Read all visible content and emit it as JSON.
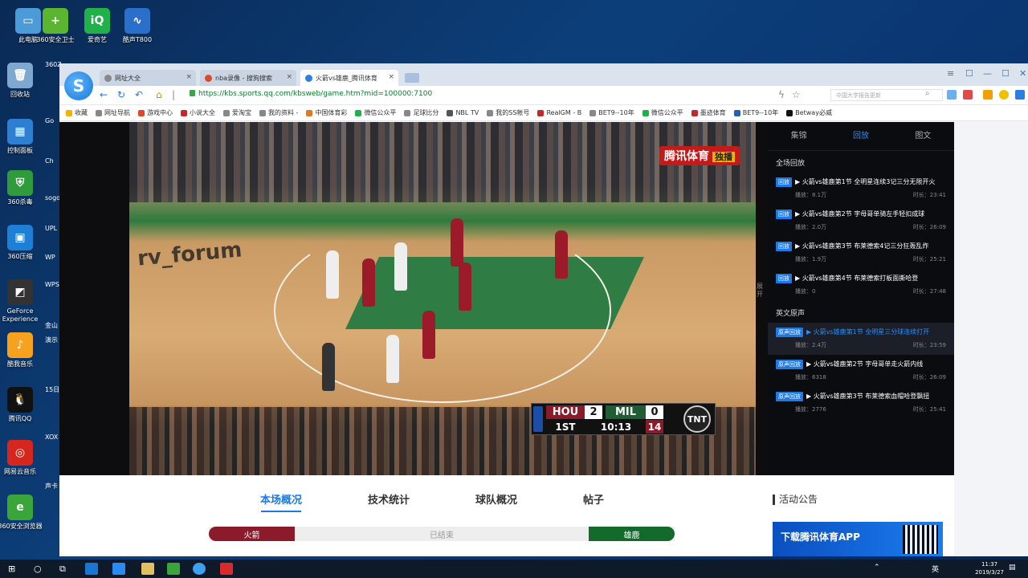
{
  "desktop": {
    "icons": [
      {
        "label": "此电脑",
        "color": "#4a9bd8",
        "glyph": "▭"
      },
      {
        "label": "360安全卫士",
        "color": "#5cb531",
        "glyph": "+"
      },
      {
        "label": "爱奇艺",
        "color": "#21b14a",
        "glyph": "iQ"
      },
      {
        "label": "酷声T800",
        "color": "#2a6fc9",
        "glyph": "∿"
      },
      {
        "label": "回收站",
        "color": "#7fa8d0",
        "glyph": "🗑"
      },
      {
        "label": "控制面板",
        "color": "#2d7fd2",
        "glyph": "▦"
      },
      {
        "label": "360杀毒",
        "color": "#2f9b3a",
        "glyph": "⛨"
      },
      {
        "label": "360压缩",
        "color": "#1e7fd6",
        "glyph": "▣"
      },
      {
        "label": "GeForce Experience",
        "color": "#333",
        "glyph": "◩"
      },
      {
        "label": "酷我音乐",
        "color": "#f6a21e",
        "glyph": "♪"
      },
      {
        "label": "腾讯QQ",
        "color": "#111",
        "glyph": "🐧"
      },
      {
        "label": "网易云音乐",
        "color": "#d6271f",
        "glyph": "◎"
      },
      {
        "label": "360安全浏览器",
        "color": "#3aa63a",
        "glyph": "e"
      }
    ],
    "partial_labels": [
      "360Z",
      "Go",
      "Ch",
      "sogo",
      "UPL",
      "WP",
      "WPS",
      "金山",
      "演示",
      "15日",
      "XOX",
      "声卡"
    ]
  },
  "browser": {
    "logo_glyph": "S",
    "tabs": [
      {
        "label": "网址大全",
        "active": false,
        "fav_color": "#888"
      },
      {
        "label": "nba录像 - 搜狗搜索",
        "active": false,
        "fav_color": "#e0472a"
      },
      {
        "label": "火箭vs雄鹿_腾讯体育",
        "active": true,
        "fav_color": "#2a7fe0"
      }
    ],
    "url": "https://kbs.sports.qq.com/kbsweb/game.htm?mid=100000:7100",
    "search_placeholder": "中国大学报告更新",
    "bookmarks": [
      {
        "label": "收藏",
        "color": "#f2b200"
      },
      {
        "label": "网址导航",
        "color": "#888"
      },
      {
        "label": "游戏中心",
        "color": "#e0472a"
      },
      {
        "label": "小说大全",
        "color": "#c62828"
      },
      {
        "label": "爱淘宝",
        "color": "#888"
      },
      {
        "label": "我的资料 -",
        "color": "#888"
      },
      {
        "label": "中国体育彩",
        "color": "#e07a1e"
      },
      {
        "label": "微信公众平",
        "color": "#21b14a"
      },
      {
        "label": "足球比分",
        "color": "#888"
      },
      {
        "label": "NBL TV",
        "color": "#555"
      },
      {
        "label": "我的SS帐号",
        "color": "#888"
      },
      {
        "label": "RealGM - B",
        "color": "#c62828"
      },
      {
        "label": "BET9--10年",
        "color": "#888"
      },
      {
        "label": "微信公众平",
        "color": "#21b14a"
      },
      {
        "label": "墨迹体育",
        "color": "#c62828"
      },
      {
        "label": "BET9--10年",
        "color": "#2a5fb0"
      },
      {
        "label": "Betway必威",
        "color": "#111"
      }
    ]
  },
  "video": {
    "watermark": "rv_forum",
    "sponsor": "腾讯体育",
    "sponsor_tag": "独播",
    "scoreboard": {
      "home_team": "HOU",
      "home_score": "2",
      "away_team": "MIL",
      "away_score": "0",
      "period": "1ST",
      "clock": "10:13",
      "shot_clock": "14",
      "network": "TNT"
    },
    "expand_handle": "展开"
  },
  "side_panel": {
    "tabs": [
      "集锦",
      "回放",
      "图文"
    ],
    "active_tab": 1,
    "section_full": "全场回放",
    "section_english": "英文原声",
    "full_replays": [
      {
        "badge": "回放",
        "title": "火箭vs雄鹿第1节 全明星连续3记三分无限开火",
        "views": "播放：8.1万",
        "duration": "时长：23:41"
      },
      {
        "badge": "回放",
        "title": "火箭vs雄鹿第2节 字母哥单骑左手轻扣成球",
        "views": "播放：2.0万",
        "duration": "时长：26:09"
      },
      {
        "badge": "回放",
        "title": "火箭vs雄鹿第3节 布莱德索4记三分狂轰乱炸",
        "views": "播放：1.9万",
        "duration": "时长：25:21"
      },
      {
        "badge": "回放",
        "title": "火箭vs雄鹿第4节 布莱德索打板面撕哈登",
        "views": "播放：0",
        "duration": "时长：27:48"
      }
    ],
    "english_replays": [
      {
        "badge": "原声回放",
        "title": "火箭vs雄鹿第1节 全明星三分球连续打开",
        "views": "播放：2.4万",
        "duration": "时长：23:59",
        "highlight": true
      },
      {
        "badge": "原声回放",
        "title": "火箭vs雄鹿第2节 字母哥单走火箭内线",
        "views": "播放：6318",
        "duration": "时长：26:09",
        "highlight": false
      },
      {
        "badge": "原声回放",
        "title": "火箭vs雄鹿第3节 布莱德索血帽哈登飘扭",
        "views": "播放：2776",
        "duration": "时长：25:41",
        "highlight": false
      }
    ]
  },
  "content": {
    "tabs": [
      "本场概况",
      "技术统计",
      "球队概况",
      "帖子"
    ],
    "active_tab": 0,
    "status_left": "火箭",
    "status_mid": "已结束",
    "status_right": "雄鹿",
    "notice_title": "活动公告",
    "ad_text": "下载腾讯体育APP"
  },
  "taskbar": {
    "ime": "英",
    "time": "11:37",
    "date": "2019/3/27"
  }
}
